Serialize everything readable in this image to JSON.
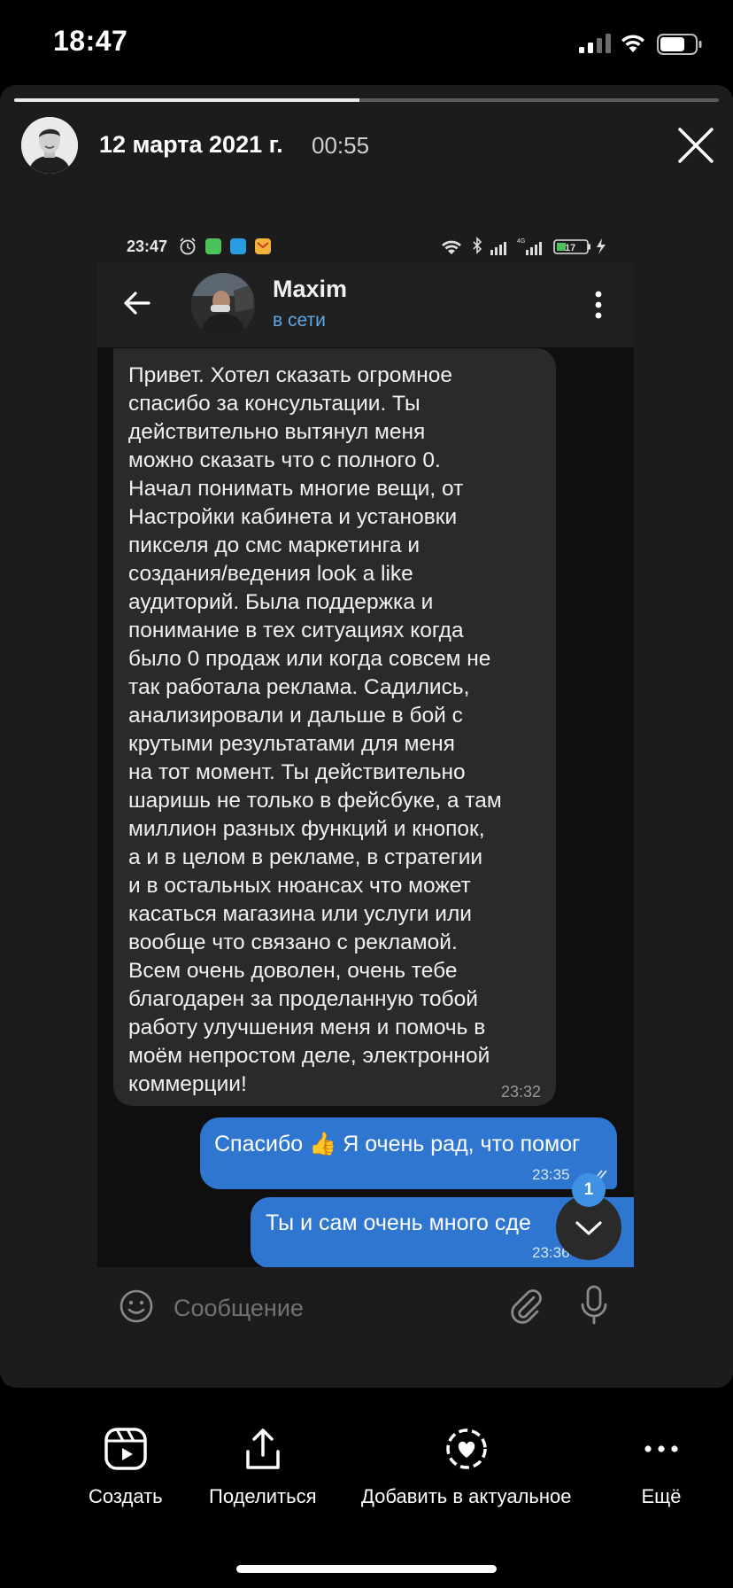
{
  "ios_status_bar": {
    "time": "18:47",
    "icons": [
      "cellular-signal-icon",
      "wifi-icon",
      "battery-icon"
    ]
  },
  "story": {
    "progress": 0.49,
    "date": "12 марта 2021 г.",
    "duration": "00:55",
    "icons": [
      "author-avatar",
      "close-icon"
    ]
  },
  "screenshot": {
    "android_status_bar": {
      "time": "23:47",
      "battery": "17",
      "icons": [
        "alarm-icon",
        "app-icon",
        "app-icon",
        "mail-icon",
        "wifi-icon",
        "bluetooth-icon",
        "signal-icon",
        "charging-icon"
      ]
    },
    "chat": {
      "contact_name": "Maxim",
      "contact_status": "в сети",
      "messages": [
        {
          "direction": "incoming",
          "text": "Привет. Хотел сказать огромное\nспасибо за консультации. Ты\nдействительно вытянул меня\nможно сказать что с полного 0.\nНачал понимать многие вещи, от\nНастройки кабинета и установки\nпикселя до смс маркетинга и\nсоздания/ведения look a like\nаудиторий. Была поддержка и\nпонимание в тех ситуациях когда\nбыло 0 продаж или когда совсем не\nтак работала реклама. Садились,\nанализировали и дальше в бой с\nкрутыми результатами для меня\nна тот момент. Ты действительно\nшаришь не только в фейсбуке, а там\nмиллион разных функций и кнопок,\nа и в целом в рекламе, в стратегии\nи в остальных нюансах что может\nкасаться магазина или услуги или\nвообще что связано с рекламой.\nВсем очень доволен, очень тебе\nблагодарен за проделанную тобой\nработу улучшения меня и помочь в\nмоём непростом деле, электронной\nкоммерции!",
          "time": "23:32"
        },
        {
          "direction": "outgoing",
          "text": "Спасибо 👍 Я очень рад, что помог",
          "time": "23:35"
        },
        {
          "direction": "outgoing",
          "text": "Ты и сам очень много сде",
          "time": "23:36"
        }
      ],
      "unread_count": "1",
      "input_placeholder": "Сообщение"
    }
  },
  "actions": [
    {
      "label": "Создать",
      "icon": "reels-create-icon"
    },
    {
      "label": "Поделиться",
      "icon": "share-icon"
    },
    {
      "label": "Добавить в актуальное",
      "icon": "highlight-heart-icon"
    },
    {
      "label": "Ещё",
      "icon": "more-dots-icon"
    }
  ],
  "colors": {
    "accent_blue": "#2f76d1",
    "status_blue": "#5fa8e6",
    "bubble_gray": "#2a2a2a"
  }
}
